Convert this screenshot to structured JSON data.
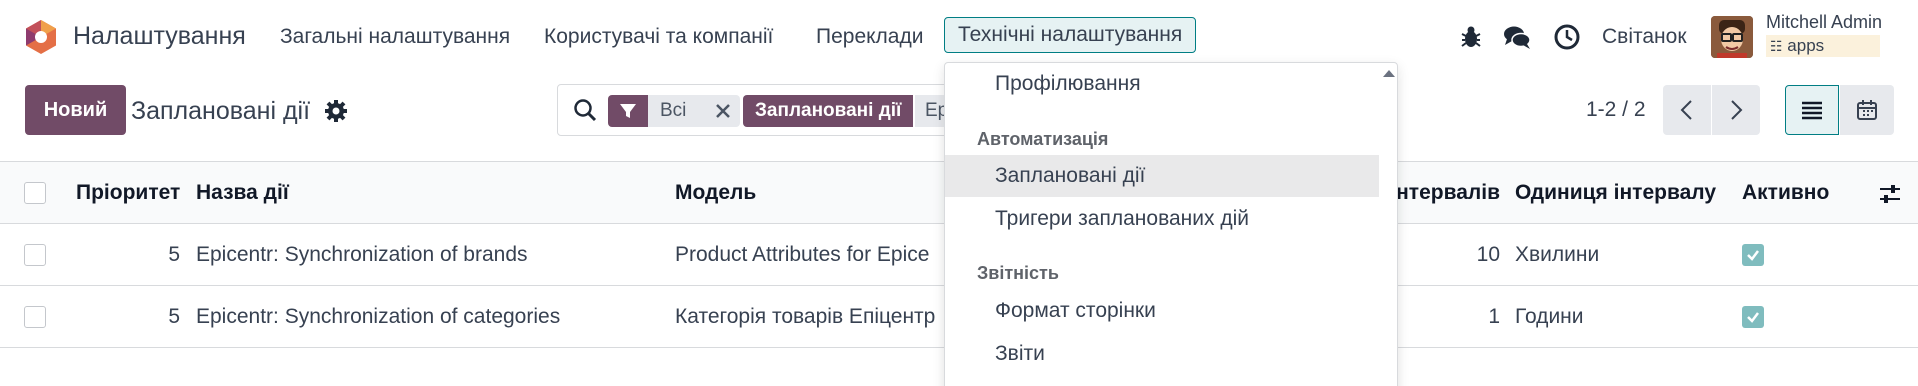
{
  "nav": {
    "app_name": "Налаштування",
    "menu": [
      "Загальні налаштування",
      "Користувачі та компанії",
      "Переклади",
      "Технічні налаштування"
    ],
    "company": "Світанок",
    "user_name": "Mitchell Admin",
    "db_name": "apps",
    "icons": [
      "bug-icon",
      "chat-icon",
      "clock-icon"
    ]
  },
  "control": {
    "new_label": "Новий",
    "title": "Заплановані дії",
    "facet1_value": "Всі",
    "facet2_label": "Заплановані дії",
    "facet2_value": "Ep",
    "pager": "1-2 / 2"
  },
  "table": {
    "headers": [
      "Пріоритет",
      "Назва дії",
      "Модель",
      "Інтервалів",
      "Одиниця інтервалу",
      "Активно"
    ],
    "rows": [
      {
        "priority": "5",
        "name": "Epicentr: Synchronization of brands",
        "model": "Product Attributes for Epice",
        "interval": "10",
        "unit": "Хвилини",
        "active": true
      },
      {
        "priority": "5",
        "name": "Epicentr: Synchronization of categories",
        "model": "Категорія товарів Епіцентр",
        "interval": "1",
        "unit": "Години",
        "active": true
      }
    ]
  },
  "dropdown": {
    "item_top": "Профілювання",
    "section1": "Автоматизація",
    "section1_items": [
      "Заплановані дії",
      "Тригери запланованих дій"
    ],
    "section2": "Звітність",
    "section2_items": [
      "Формат сторінки",
      "Звіти"
    ]
  },
  "colors": {
    "brand": "#714b67",
    "accent": "#017e84",
    "checkbox_on": "#7fbcbe"
  }
}
